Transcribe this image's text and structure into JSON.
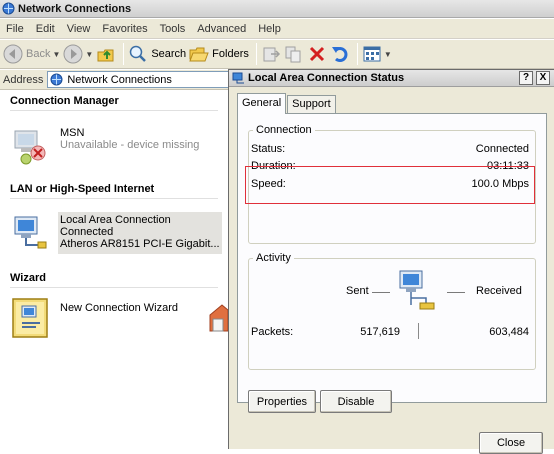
{
  "window": {
    "title": "Network Connections"
  },
  "menu": [
    "File",
    "Edit",
    "View",
    "Favorites",
    "Tools",
    "Advanced",
    "Help"
  ],
  "toolbar": {
    "back_label": "Back",
    "search_label": "Search",
    "folders_label": "Folders"
  },
  "address": {
    "label": "Address",
    "value": "Network Connections"
  },
  "groups": {
    "connection_manager": "Connection Manager",
    "lan": "LAN or High-Speed Internet",
    "wizard": "Wizard"
  },
  "items": {
    "msn": {
      "name": "MSN",
      "status": "Unavailable - device missing"
    },
    "lan": {
      "name": "Local Area Connection",
      "status": "Connected",
      "device": "Atheros AR8151 PCI-E Gigabit..."
    },
    "wizard": {
      "name": "New Connection Wizard"
    }
  },
  "dialog": {
    "title": "Local Area Connection Status",
    "help_button": "?",
    "close_x": "X",
    "tabs": [
      "General",
      "Support"
    ],
    "connection": {
      "legend": "Connection",
      "status_label": "Status:",
      "status_value": "Connected",
      "duration_label": "Duration:",
      "duration_value": "03:11:33",
      "speed_label": "Speed:",
      "speed_value": "100.0 Mbps"
    },
    "activity": {
      "legend": "Activity",
      "sent_label": "Sent",
      "received_label": "Received",
      "packets_label": "Packets:",
      "sent_value": "517,619",
      "received_value": "603,484"
    },
    "properties_button": "Properties",
    "disable_button": "Disable",
    "close_button": "Close"
  },
  "colors": {
    "highlight_box": "#e0303a",
    "dialog_bg": "#ece9d8"
  }
}
